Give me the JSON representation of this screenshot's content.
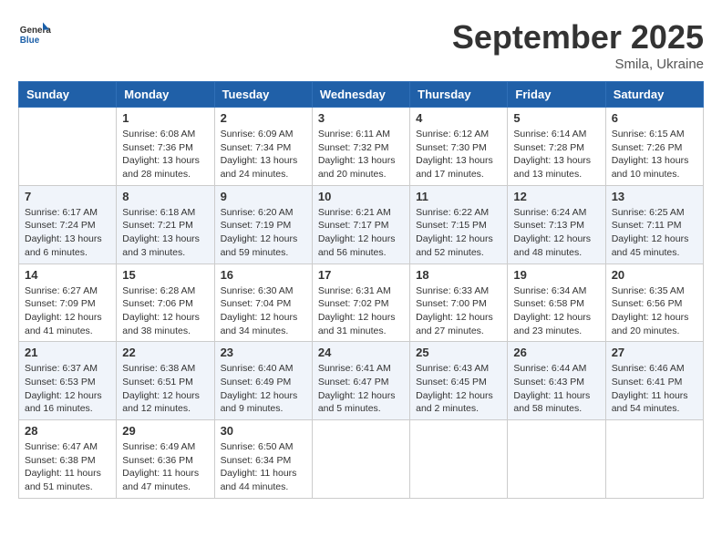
{
  "header": {
    "logo_general": "General",
    "logo_blue": "Blue",
    "month_title": "September 2025",
    "subtitle": "Smila, Ukraine"
  },
  "weekdays": [
    "Sunday",
    "Monday",
    "Tuesday",
    "Wednesday",
    "Thursday",
    "Friday",
    "Saturday"
  ],
  "weeks": [
    [
      {
        "day": "",
        "info": ""
      },
      {
        "day": "1",
        "info": "Sunrise: 6:08 AM\nSunset: 7:36 PM\nDaylight: 13 hours\nand 28 minutes."
      },
      {
        "day": "2",
        "info": "Sunrise: 6:09 AM\nSunset: 7:34 PM\nDaylight: 13 hours\nand 24 minutes."
      },
      {
        "day": "3",
        "info": "Sunrise: 6:11 AM\nSunset: 7:32 PM\nDaylight: 13 hours\nand 20 minutes."
      },
      {
        "day": "4",
        "info": "Sunrise: 6:12 AM\nSunset: 7:30 PM\nDaylight: 13 hours\nand 17 minutes."
      },
      {
        "day": "5",
        "info": "Sunrise: 6:14 AM\nSunset: 7:28 PM\nDaylight: 13 hours\nand 13 minutes."
      },
      {
        "day": "6",
        "info": "Sunrise: 6:15 AM\nSunset: 7:26 PM\nDaylight: 13 hours\nand 10 minutes."
      }
    ],
    [
      {
        "day": "7",
        "info": "Sunrise: 6:17 AM\nSunset: 7:24 PM\nDaylight: 13 hours\nand 6 minutes."
      },
      {
        "day": "8",
        "info": "Sunrise: 6:18 AM\nSunset: 7:21 PM\nDaylight: 13 hours\nand 3 minutes."
      },
      {
        "day": "9",
        "info": "Sunrise: 6:20 AM\nSunset: 7:19 PM\nDaylight: 12 hours\nand 59 minutes."
      },
      {
        "day": "10",
        "info": "Sunrise: 6:21 AM\nSunset: 7:17 PM\nDaylight: 12 hours\nand 56 minutes."
      },
      {
        "day": "11",
        "info": "Sunrise: 6:22 AM\nSunset: 7:15 PM\nDaylight: 12 hours\nand 52 minutes."
      },
      {
        "day": "12",
        "info": "Sunrise: 6:24 AM\nSunset: 7:13 PM\nDaylight: 12 hours\nand 48 minutes."
      },
      {
        "day": "13",
        "info": "Sunrise: 6:25 AM\nSunset: 7:11 PM\nDaylight: 12 hours\nand 45 minutes."
      }
    ],
    [
      {
        "day": "14",
        "info": "Sunrise: 6:27 AM\nSunset: 7:09 PM\nDaylight: 12 hours\nand 41 minutes."
      },
      {
        "day": "15",
        "info": "Sunrise: 6:28 AM\nSunset: 7:06 PM\nDaylight: 12 hours\nand 38 minutes."
      },
      {
        "day": "16",
        "info": "Sunrise: 6:30 AM\nSunset: 7:04 PM\nDaylight: 12 hours\nand 34 minutes."
      },
      {
        "day": "17",
        "info": "Sunrise: 6:31 AM\nSunset: 7:02 PM\nDaylight: 12 hours\nand 31 minutes."
      },
      {
        "day": "18",
        "info": "Sunrise: 6:33 AM\nSunset: 7:00 PM\nDaylight: 12 hours\nand 27 minutes."
      },
      {
        "day": "19",
        "info": "Sunrise: 6:34 AM\nSunset: 6:58 PM\nDaylight: 12 hours\nand 23 minutes."
      },
      {
        "day": "20",
        "info": "Sunrise: 6:35 AM\nSunset: 6:56 PM\nDaylight: 12 hours\nand 20 minutes."
      }
    ],
    [
      {
        "day": "21",
        "info": "Sunrise: 6:37 AM\nSunset: 6:53 PM\nDaylight: 12 hours\nand 16 minutes."
      },
      {
        "day": "22",
        "info": "Sunrise: 6:38 AM\nSunset: 6:51 PM\nDaylight: 12 hours\nand 12 minutes."
      },
      {
        "day": "23",
        "info": "Sunrise: 6:40 AM\nSunset: 6:49 PM\nDaylight: 12 hours\nand 9 minutes."
      },
      {
        "day": "24",
        "info": "Sunrise: 6:41 AM\nSunset: 6:47 PM\nDaylight: 12 hours\nand 5 minutes."
      },
      {
        "day": "25",
        "info": "Sunrise: 6:43 AM\nSunset: 6:45 PM\nDaylight: 12 hours\nand 2 minutes."
      },
      {
        "day": "26",
        "info": "Sunrise: 6:44 AM\nSunset: 6:43 PM\nDaylight: 11 hours\nand 58 minutes."
      },
      {
        "day": "27",
        "info": "Sunrise: 6:46 AM\nSunset: 6:41 PM\nDaylight: 11 hours\nand 54 minutes."
      }
    ],
    [
      {
        "day": "28",
        "info": "Sunrise: 6:47 AM\nSunset: 6:38 PM\nDaylight: 11 hours\nand 51 minutes."
      },
      {
        "day": "29",
        "info": "Sunrise: 6:49 AM\nSunset: 6:36 PM\nDaylight: 11 hours\nand 47 minutes."
      },
      {
        "day": "30",
        "info": "Sunrise: 6:50 AM\nSunset: 6:34 PM\nDaylight: 11 hours\nand 44 minutes."
      },
      {
        "day": "",
        "info": ""
      },
      {
        "day": "",
        "info": ""
      },
      {
        "day": "",
        "info": ""
      },
      {
        "day": "",
        "info": ""
      }
    ]
  ]
}
